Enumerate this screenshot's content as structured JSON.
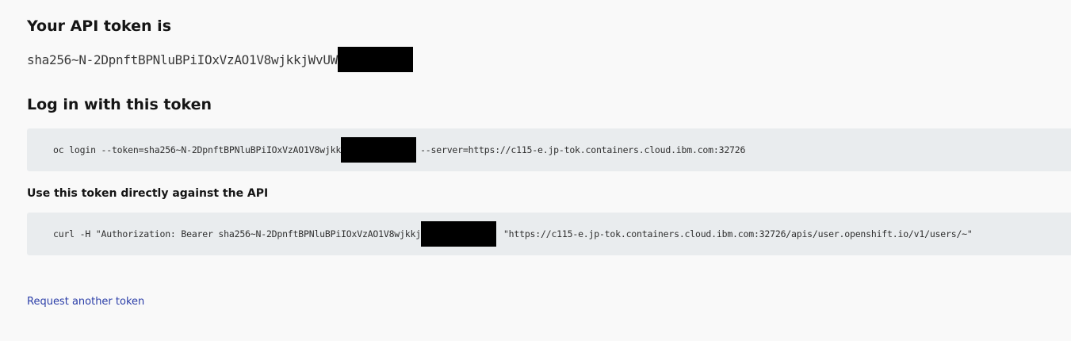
{
  "token_section": {
    "heading": "Your API token is",
    "token_visible": "sha256~N-2DpnftBPNluBPiIOxVzAO1V8wjkkjWvUW"
  },
  "login_section": {
    "heading": "Log in with this token",
    "command_prefix": "oc login --token=sha256~N-2DpnftBPNluBPiIOxVzAO1V8wjkk",
    "command_suffix": "--server=https://c115-e.jp-tok.containers.cloud.ibm.com:32726"
  },
  "api_section": {
    "heading": "Use this token directly against the API",
    "command_prefix": "curl -H \"Authorization: Bearer sha256~N-2DpnftBPNluBPiIOxVzAO1V8wjkkj",
    "command_suffix": "\"https://c115-e.jp-tok.containers.cloud.ibm.com:32726/apis/user.openshift.io/v1/users/~\""
  },
  "request_link": "Request another token",
  "colors": {
    "page_bg": "#f9f9f9",
    "code_bg": "#e9ecee",
    "link": "#2b3ea8",
    "redaction": "#000000"
  }
}
